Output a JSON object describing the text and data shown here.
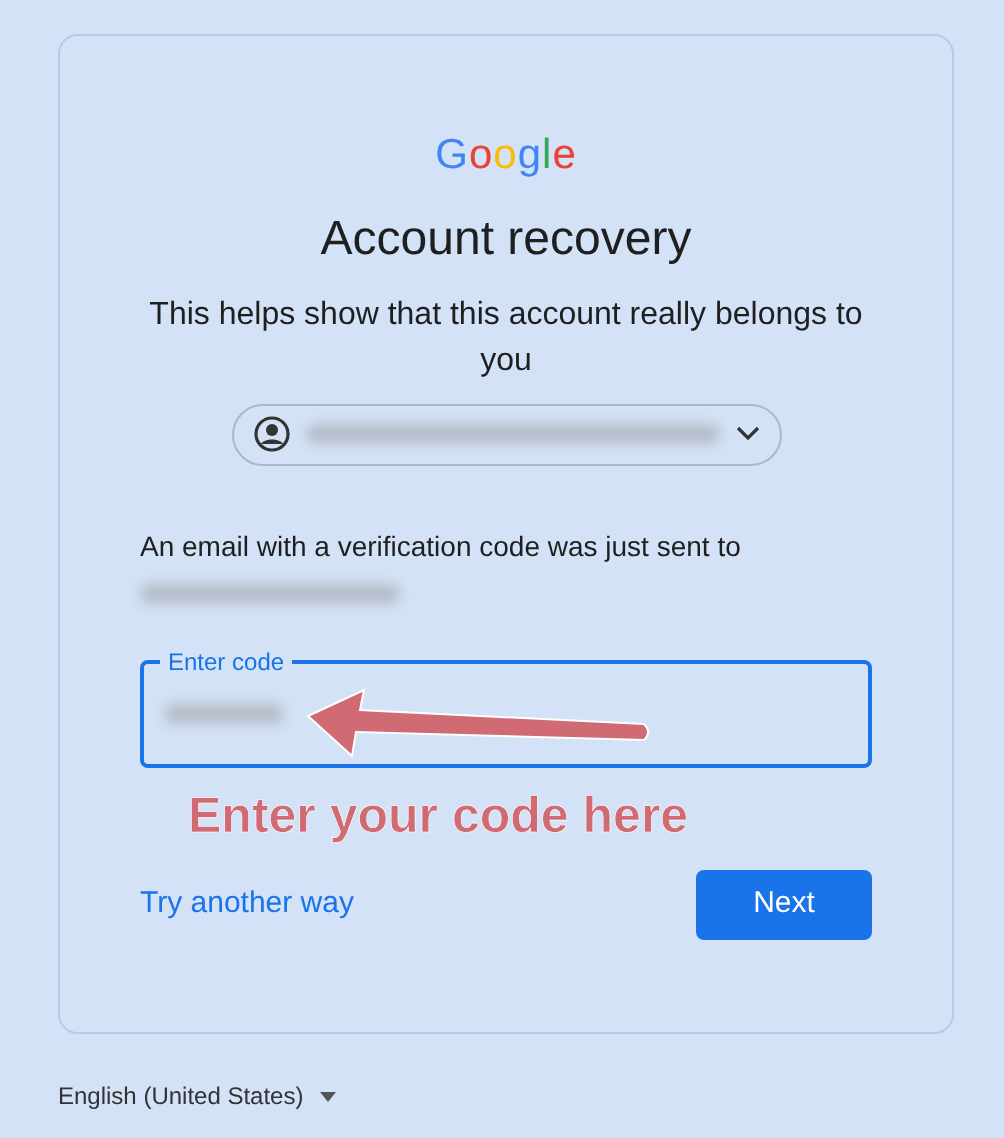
{
  "logo": "Google",
  "title": "Account recovery",
  "subtitle": "This helps show that this account really belongs to you",
  "account_chip": {
    "redacted": true
  },
  "message": "An email with a verification code was just sent to",
  "code_field": {
    "label": "Enter code",
    "focused": true
  },
  "annotation": {
    "text": "Enter your code here"
  },
  "link": "Try another way",
  "next_button": "Next",
  "footer": {
    "language": "English (United States)"
  }
}
